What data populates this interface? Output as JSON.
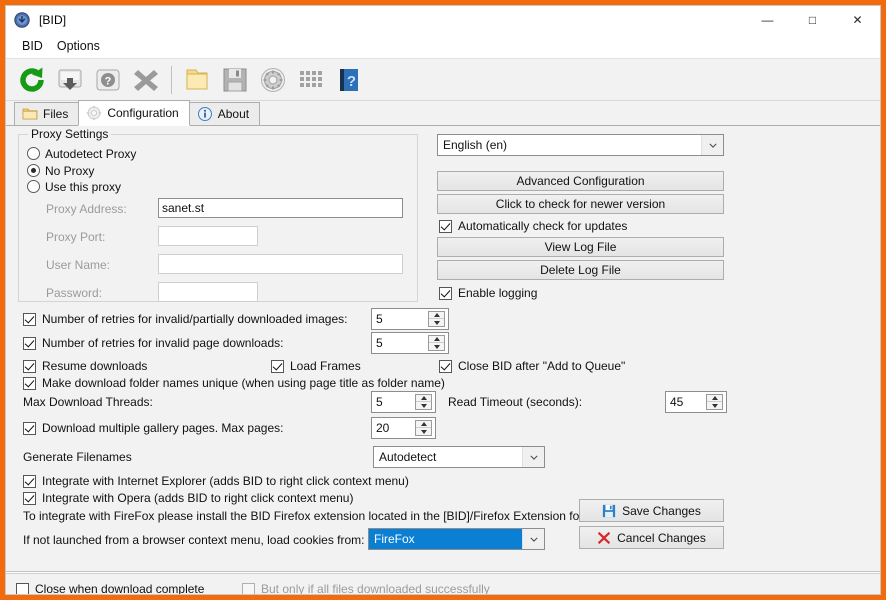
{
  "window": {
    "title": "[BID]",
    "app_icon": "bid-globe-icon",
    "frame_color": "#f26b0f",
    "minimize_label": "—",
    "maximize_label": "□",
    "close_label": "✕"
  },
  "menubar": {
    "items": [
      {
        "label": "BID"
      },
      {
        "label": "Options"
      }
    ]
  },
  "toolbar": {
    "buttons": [
      {
        "name": "refresh-icon",
        "tip": "Refresh"
      },
      {
        "name": "download-icon",
        "tip": "Download"
      },
      {
        "name": "help-disk-icon",
        "tip": "Help"
      },
      {
        "name": "delete-x-icon",
        "tip": "Delete"
      },
      {
        "name": "folder-icon",
        "tip": "Open Folder"
      },
      {
        "name": "save-disk-icon",
        "tip": "Save"
      },
      {
        "name": "settings-gear-icon",
        "tip": "Settings"
      },
      {
        "name": "grid-icon",
        "tip": "Grid"
      },
      {
        "name": "help-book-icon",
        "tip": "Manual"
      }
    ]
  },
  "tabs": [
    {
      "label": "Files",
      "icon": "folder-icon",
      "active": false
    },
    {
      "label": "Configuration",
      "icon": "gear-icon",
      "active": true
    },
    {
      "label": "About",
      "icon": "info-icon",
      "active": false
    }
  ],
  "proxy": {
    "group_title": "Proxy Settings",
    "options": [
      {
        "label": "Autodetect Proxy",
        "selected": false
      },
      {
        "label": "No Proxy",
        "selected": true
      },
      {
        "label": "Use this proxy",
        "selected": false
      }
    ],
    "fields": [
      {
        "label": "Proxy Address:",
        "value": "sanet.st",
        "enabled_look": true
      },
      {
        "label": "Proxy Port:",
        "value": "",
        "enabled_look": false
      },
      {
        "label": "User Name:",
        "value": "",
        "enabled_look": false
      },
      {
        "label": "Password:",
        "value": "",
        "enabled_look": false
      }
    ]
  },
  "right_panel": {
    "language": {
      "value": "English (en)"
    },
    "advanced_config_label": "Advanced Configuration",
    "check_version_label": "Click to check for newer version",
    "auto_update": {
      "label": "Automatically check for updates",
      "checked": true
    },
    "view_log_label": "View Log File",
    "delete_log_label": "Delete Log File",
    "enable_logging": {
      "label": "Enable logging",
      "checked": true
    }
  },
  "options": {
    "retries_images": {
      "label": "Number of retries for invalid/partially downloaded images:",
      "checked": true,
      "value": "5"
    },
    "retries_pages": {
      "label": "Number of retries for invalid page downloads:",
      "checked": true,
      "value": "5"
    },
    "resume_downloads": {
      "label": "Resume downloads",
      "checked": true
    },
    "load_frames": {
      "label": "Load Frames",
      "checked": true
    },
    "close_after_queue": {
      "label": "Close BID after \"Add to Queue\"",
      "checked": true
    },
    "unique_folder_names": {
      "label": "Make download folder names unique (when using page title as folder name)",
      "checked": true
    },
    "max_threads": {
      "label": "Max Download Threads:",
      "value": "5"
    },
    "read_timeout": {
      "label": "Read Timeout (seconds):",
      "value": "45"
    },
    "multi_gallery": {
      "label": "Download multiple gallery pages. Max pages:",
      "checked": true,
      "value": "20"
    },
    "generate_filenames": {
      "label": "Generate Filenames",
      "value": "Autodetect"
    },
    "integrate_ie": {
      "label": "Integrate with Internet Explorer (adds BID to right click context menu)",
      "checked": true
    },
    "integrate_opera": {
      "label": "Integrate with Opera (adds BID to right click context menu)",
      "checked": true
    },
    "firefox_note": "To integrate with FireFox please install the BID Firefox extension located in the [BID]/Firefox Extension folder.",
    "cookies_label": "If not launched from a browser context menu, load cookies from:",
    "cookies_value": "FireFox"
  },
  "action_buttons": {
    "save_label": "Save Changes",
    "cancel_label": "Cancel Changes"
  },
  "statusbar": {
    "close_when_done": {
      "label": "Close when download complete",
      "checked": false
    },
    "only_if_success": {
      "label": "But only if all files downloaded successfully",
      "checked": false,
      "disabled": true
    }
  },
  "colors": {
    "window_frame": "#f26b0f",
    "panel_bg": "#f2f2f2",
    "selection_blue": "#0b7fd4",
    "toolbar_bg": "#f2f2f2"
  }
}
